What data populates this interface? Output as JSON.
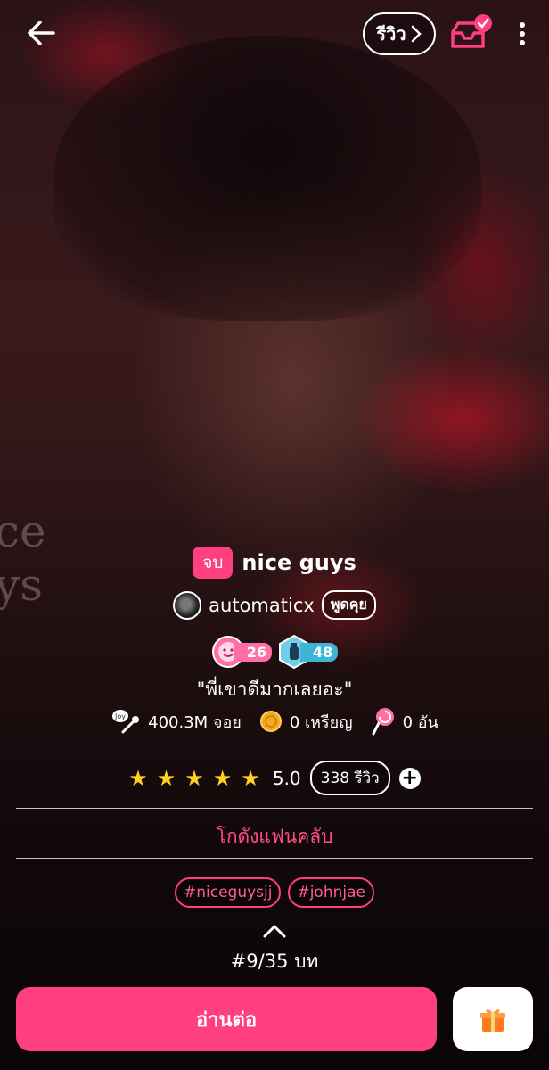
{
  "header": {
    "review_label": "รีวิว"
  },
  "cover": {
    "text_line1": "ce",
    "text_line2": "ys"
  },
  "story": {
    "status": "จบ",
    "title": "nice guys",
    "author": "automaticx",
    "chat_label": "พูดคุย",
    "badge_1": "26",
    "badge_2": "48",
    "tagline": "\"พี่เขาดีมากเลยอะ\"",
    "stats": {
      "views": "400.3M จอย",
      "coins": "0 เหรียญ",
      "candies": "0 อัน"
    },
    "rating": "5.0",
    "stars": 5,
    "review_count": "338 รีวิว",
    "fanclub": "โกดังแฟนคลับ",
    "tags": [
      "#niceguysjj",
      "#johnjae"
    ],
    "episode": "#9/35 บท"
  },
  "actions": {
    "read_label": "อ่านต่อ"
  },
  "colors": {
    "accent": "#ff3f7f",
    "star": "#ffd21f"
  }
}
